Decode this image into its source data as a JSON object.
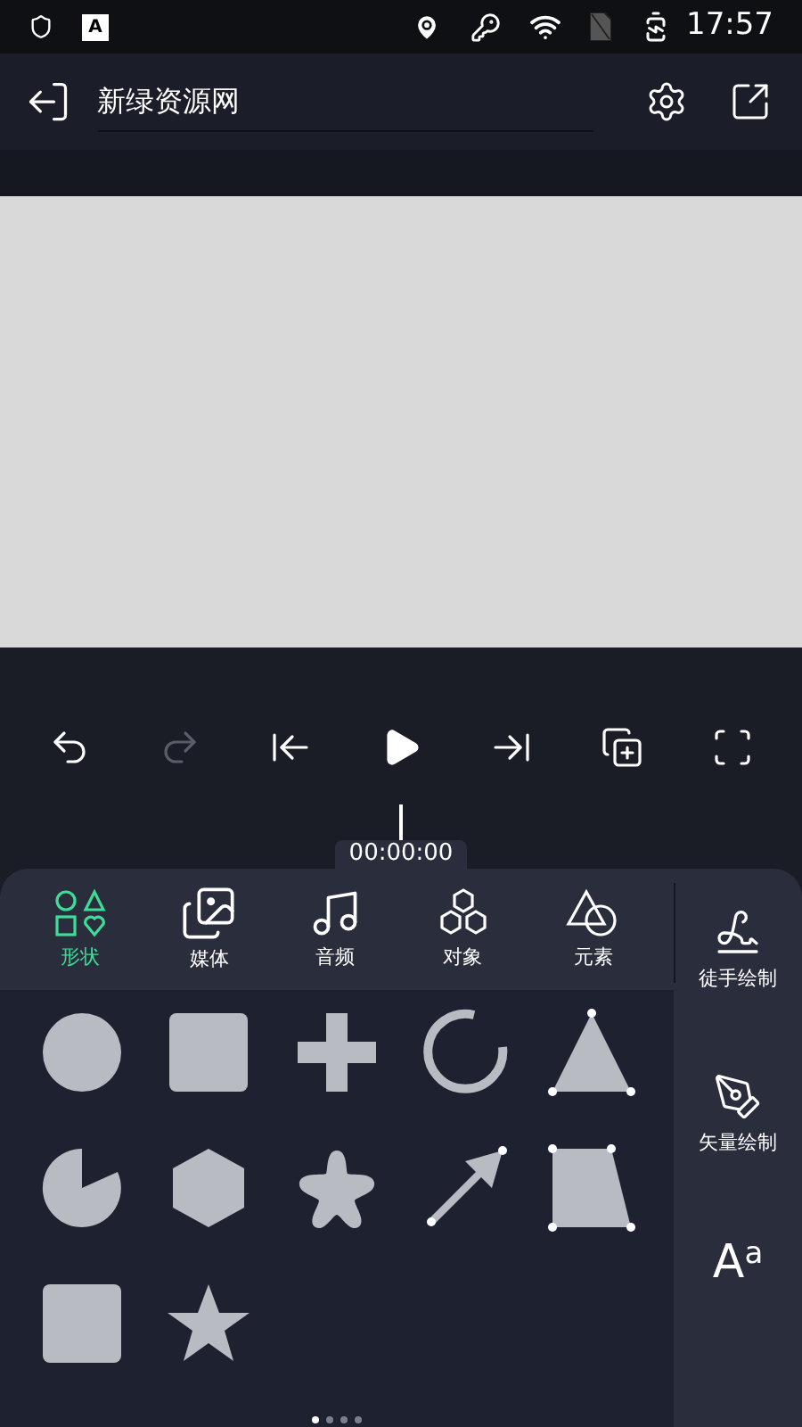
{
  "status_bar": {
    "app_badge": "A",
    "time": "17:57"
  },
  "toolbar": {
    "title": "新绿资源网"
  },
  "controls": [
    {
      "kind": "undo",
      "disabled": false
    },
    {
      "kind": "redo",
      "disabled": true
    },
    {
      "kind": "start",
      "disabled": false
    },
    {
      "kind": "play",
      "disabled": false
    },
    {
      "kind": "end",
      "disabled": false
    },
    {
      "kind": "duplicate",
      "disabled": false
    },
    {
      "kind": "fit",
      "disabled": false
    }
  ],
  "timeline": {
    "time": "00:00:00"
  },
  "tabs": [
    {
      "kind": "shapes",
      "label": "形状",
      "selected": true
    },
    {
      "kind": "media",
      "label": "媒体",
      "selected": false
    },
    {
      "kind": "audio",
      "label": "音频",
      "selected": false
    },
    {
      "kind": "objects",
      "label": "对象",
      "selected": false
    },
    {
      "kind": "elements",
      "label": "元素",
      "selected": false
    }
  ],
  "side_tools": [
    {
      "kind": "freehand",
      "label": "徒手绘制"
    },
    {
      "kind": "vector",
      "label": "矢量绘制"
    },
    {
      "kind": "text",
      "glyph": "A",
      "superscript": "a"
    }
  ],
  "shapes": [
    {
      "kind": "circle"
    },
    {
      "kind": "square"
    },
    {
      "kind": "plus"
    },
    {
      "kind": "arc"
    },
    {
      "kind": "triangle"
    },
    {
      "kind": "pie"
    },
    {
      "kind": "hexagon"
    },
    {
      "kind": "flower"
    },
    {
      "kind": "arrow"
    },
    {
      "kind": "trapezoid"
    },
    {
      "kind": "square"
    },
    {
      "kind": "star"
    }
  ],
  "pages": [
    {
      "selected": true
    },
    {
      "selected": false
    },
    {
      "selected": false
    },
    {
      "selected": false
    }
  ]
}
